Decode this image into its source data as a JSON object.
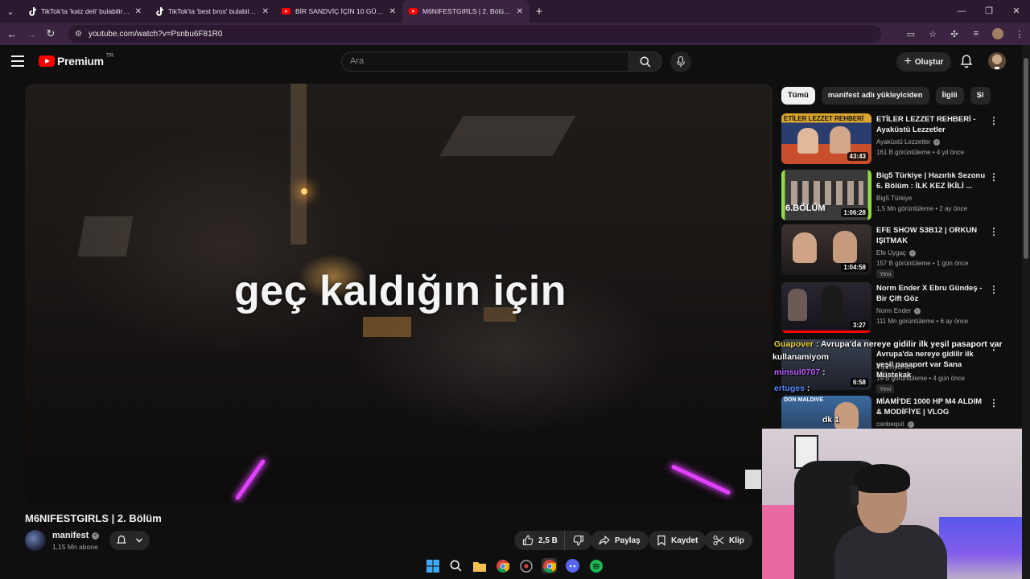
{
  "browser": {
    "tabs": [
      {
        "title": "TikTok'ta 'katz deli' bulabilirsiniz",
        "favicon": "tiktok-icon",
        "active": false
      },
      {
        "title": "TikTok'ta 'best bros' bulabilirsiniz",
        "favicon": "tiktok-icon",
        "active": false
      },
      {
        "title": "BİR SANDVİÇ İÇİN 10 GÜN !! (P",
        "favicon": "youtube-icon",
        "active": false
      },
      {
        "title": "M6NIFESTGIRLS | 2. Bölüm - Yo",
        "favicon": "youtube-icon",
        "active": true
      }
    ],
    "url": "youtube.com/watch?v=Psnbu6F81R0"
  },
  "masthead": {
    "logo_text": "Premium",
    "country_code": "TR",
    "search_placeholder": "Ara",
    "create_label": "Oluştur"
  },
  "video": {
    "subtitle": "geç kaldığın için",
    "title": "M6NIFESTGIRLS | 2. Bölüm",
    "channel": "manifest",
    "subscribers": "1,15 Mn abone",
    "likes": "2,5 B",
    "share_label": "Paylaş",
    "save_label": "Kaydet",
    "clip_label": "Klip"
  },
  "sidebar": {
    "chips": [
      "Tümü",
      "manifest adlı yükleyiciden",
      "İlgili",
      "Sl"
    ],
    "recommendations": [
      {
        "title": "ETİLER LEZZET REHBERİ - Ayaküstü Lezzetler",
        "channel": "Ayaküstü Lezzetler",
        "verified": true,
        "meta": "161 B görüntüleme • 4 yıl önce",
        "duration": "43:43",
        "badge": "",
        "thumb_text": "ETİLER LEZZET REHBERİ"
      },
      {
        "title": "Big5 Türkiye | Hazırlık Sezonu 6. Bölüm : İLK KEZ İKİLİ ...",
        "channel": "Big5 Türkiye",
        "verified": false,
        "meta": "1,5 Mn görüntüleme • 2 ay önce",
        "duration": "1:06:28",
        "badge": "",
        "thumb_text": "6.BÖLÜM"
      },
      {
        "title": "EFE SHOW S3B12 | ORKUN IŞITMAK",
        "channel": "Efe Uygaç",
        "verified": true,
        "meta": "157 B görüntüleme • 1 gün önce",
        "duration": "1:04:58",
        "badge": "Yeni",
        "thumb_text": ""
      },
      {
        "title": "Norm Ender X Ebru Gündeş - Bir Çift Göz",
        "channel": "Norm Ender",
        "verified": true,
        "meta": "111 Mn görüntüleme • 6 ay önce",
        "duration": "3:27",
        "badge": "",
        "thumb_text": ""
      },
      {
        "title": "Avrupa'da nereye gidilir ilk yeşil pasaport var Sana Müstekak",
        "channel": "ViyuViyuFan",
        "verified": false,
        "meta": "19 B görüntüleme • 4 gün önce",
        "duration": "6:58",
        "badge": "Yeni",
        "thumb_text": ""
      },
      {
        "title": "MİAMİ'DE 1000 HP M4 ALDIM & MODİFİYE | VLOG",
        "channel": "canbequit",
        "verified": true,
        "meta": "",
        "duration": "",
        "badge": "",
        "thumb_text": "DON MALDIVE"
      }
    ]
  },
  "chat": [
    {
      "user": "Guapover",
      "message": ": Avrupa'da nereye gidilir ilk yeşil pasaport var"
    },
    {
      "user": "",
      "message": "kullanamiyom"
    },
    {
      "user": "minsul0707",
      "message": ":"
    },
    {
      "user": "ertuges",
      "message": ":"
    },
    {
      "user": "",
      "message": "dk 1"
    }
  ],
  "colors": {
    "accent_red": "#ff0000",
    "browser_frame": "#3a2442",
    "chat_user_yellow": "#f0d640",
    "chat_user_purple": "#c05cff",
    "chat_user_blue": "#5a8cff"
  }
}
